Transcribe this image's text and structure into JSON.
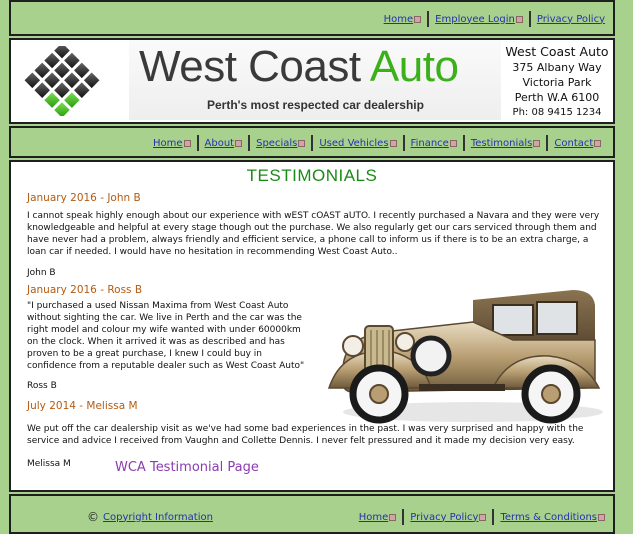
{
  "util_links": [
    "Home",
    "Employee Login",
    "Privacy Policy"
  ],
  "brand": {
    "name_main": "West Coast ",
    "name_accent": "Auto",
    "tagline": "Perth's most respected car dealership"
  },
  "address": {
    "name": "West Coast Auto",
    "street": "375 Albany Way",
    "suburb": "Victoria Park",
    "city": "Perth  W.A 6100",
    "phone": "Ph: 08 9415 1234"
  },
  "nav": [
    "Home",
    "About",
    "Specials",
    "Used Vehicles",
    "Finance",
    "Testimonials",
    "Contact"
  ],
  "main": {
    "title": "TESTIMONIALS",
    "t1_head": "January 2016 - John B",
    "t1_body": "I cannot speak highly enough about our experience with wEST cOAST aUTO. I recently purchased a Navara and they were very knowledgeable and helpful at every stage though out the purchase. We also regularly get our cars serviced through them and have never had a problem, always friendly and efficient service, a phone call to inform us if there is to be an extra charge, a loan car if needed. I would have no hesitation in recommending West Coast Auto..",
    "t1_sig": "John B",
    "t2_head": "January 2016 - Ross B",
    "t2_body": "\"I purchased a used Nissan Maxima from West Coast Auto without sighting the car. We live in Perth and the car was the right model and colour my wife wanted with under 60000km on the clock. When it arrived it was as described and has proven to be a great purchase, I knew I could buy in confidence from a reputable dealer such as West Coast Auto\"",
    "t2_sig": "Ross B",
    "t3_head": "July 2014 - Melissa M",
    "t3_body": "We put off the car dealership visit as we've had some bad experiences in the past. I was very surprised and happy with the service and advice I received from Vaughn and Collette Dennis. I never felt pressured and it made my decision very easy.",
    "t3_sig": "Melissa M",
    "page_label": "WCA Testimonial Page"
  },
  "footer": {
    "copyright_symbol": "©",
    "copyright_link": "Copyright Information",
    "links": [
      "Home",
      "Privacy Policy",
      "Terms & Conditions"
    ]
  },
  "colors": {
    "background": "#a9d18e",
    "title_green": "#1c8a18",
    "heading_orange": "#b35b12",
    "link_blue": "#2333a8",
    "label_purple": "#8a3bb0"
  }
}
